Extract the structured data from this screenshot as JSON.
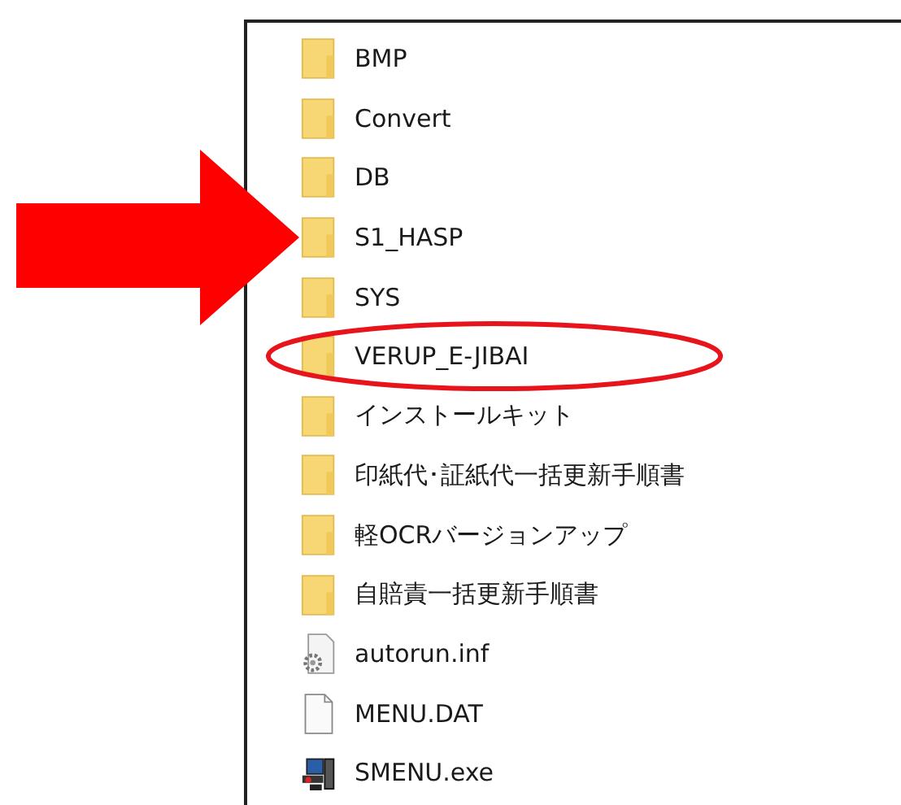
{
  "files": [
    {
      "name": "BMP",
      "kind": "folder",
      "pointed": false,
      "circled": false
    },
    {
      "name": "Convert",
      "kind": "folder",
      "pointed": false,
      "circled": false
    },
    {
      "name": "DB",
      "kind": "folder",
      "pointed": false,
      "circled": false
    },
    {
      "name": "S1_HASP",
      "kind": "folder",
      "pointed": true,
      "circled": false
    },
    {
      "name": "SYS",
      "kind": "folder",
      "pointed": false,
      "circled": false
    },
    {
      "name": "VERUP_E-JIBAI",
      "kind": "folder",
      "pointed": false,
      "circled": true
    },
    {
      "name": "インストールキット",
      "kind": "folder",
      "pointed": false,
      "circled": false
    },
    {
      "name": "印紙代･証紙代一括更新手順書",
      "kind": "folder",
      "pointed": false,
      "circled": false
    },
    {
      "name": "軽OCRバージョンアップ",
      "kind": "folder",
      "pointed": false,
      "circled": false
    },
    {
      "name": "自賠責一括更新手順書",
      "kind": "folder",
      "pointed": false,
      "circled": false
    },
    {
      "name": "autorun.inf",
      "kind": "settings",
      "pointed": false,
      "circled": false
    },
    {
      "name": "MENU.DAT",
      "kind": "file",
      "pointed": false,
      "circled": false
    },
    {
      "name": "SMENU.exe",
      "kind": "program",
      "pointed": false,
      "circled": false
    }
  ]
}
